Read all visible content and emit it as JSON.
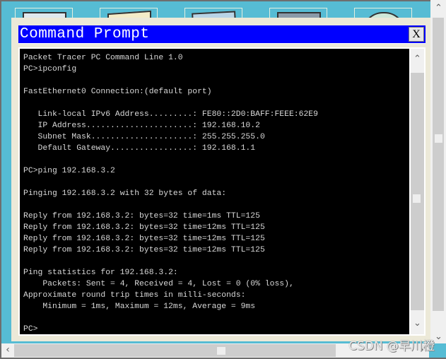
{
  "window": {
    "title": "Command Prompt",
    "close_label": "X"
  },
  "toolbar_tiles": [
    {
      "name": "physical-tab-icon"
    },
    {
      "name": "config-tab-icon"
    },
    {
      "name": "desktop-tab-icon"
    },
    {
      "name": "programming-tab-icon"
    },
    {
      "name": "attributes-tab-icon"
    }
  ],
  "terminal": {
    "lines": [
      "Packet Tracer PC Command Line 1.0",
      "PC>ipconfig",
      "",
      "FastEthernet0 Connection:(default port)",
      "",
      "   Link-local IPv6 Address.........: FE80::2D0:BAFF:FEEE:62E9",
      "   IP Address......................: 192.168.10.2",
      "   Subnet Mask.....................: 255.255.255.0",
      "   Default Gateway.................: 192.168.1.1",
      "",
      "PC>ping 192.168.3.2",
      "",
      "Pinging 192.168.3.2 with 32 bytes of data:",
      "",
      "Reply from 192.168.3.2: bytes=32 time=1ms TTL=125",
      "Reply from 192.168.3.2: bytes=32 time=12ms TTL=125",
      "Reply from 192.168.3.2: bytes=32 time=12ms TTL=125",
      "Reply from 192.168.3.2: bytes=32 time=12ms TTL=125",
      "",
      "Ping statistics for 192.168.3.2:",
      "    Packets: Sent = 4, Received = 4, Lost = 0 (0% loss),",
      "Approximate round trip times in milli-seconds:",
      "    Minimum = 1ms, Maximum = 12ms, Average = 9ms",
      "",
      "PC>"
    ]
  },
  "scrollbars": {
    "up_arrow": "^",
    "down_arrow": "v",
    "left_arrow": "<",
    "right_arrow": ">"
  },
  "watermark": "CSDN @早川橙",
  "colors": {
    "titlebar": "#0000ff",
    "background": "#56bcd4",
    "dialog": "#ece9d8",
    "terminal_bg": "#000000",
    "terminal_fg": "#d8d8d8"
  }
}
